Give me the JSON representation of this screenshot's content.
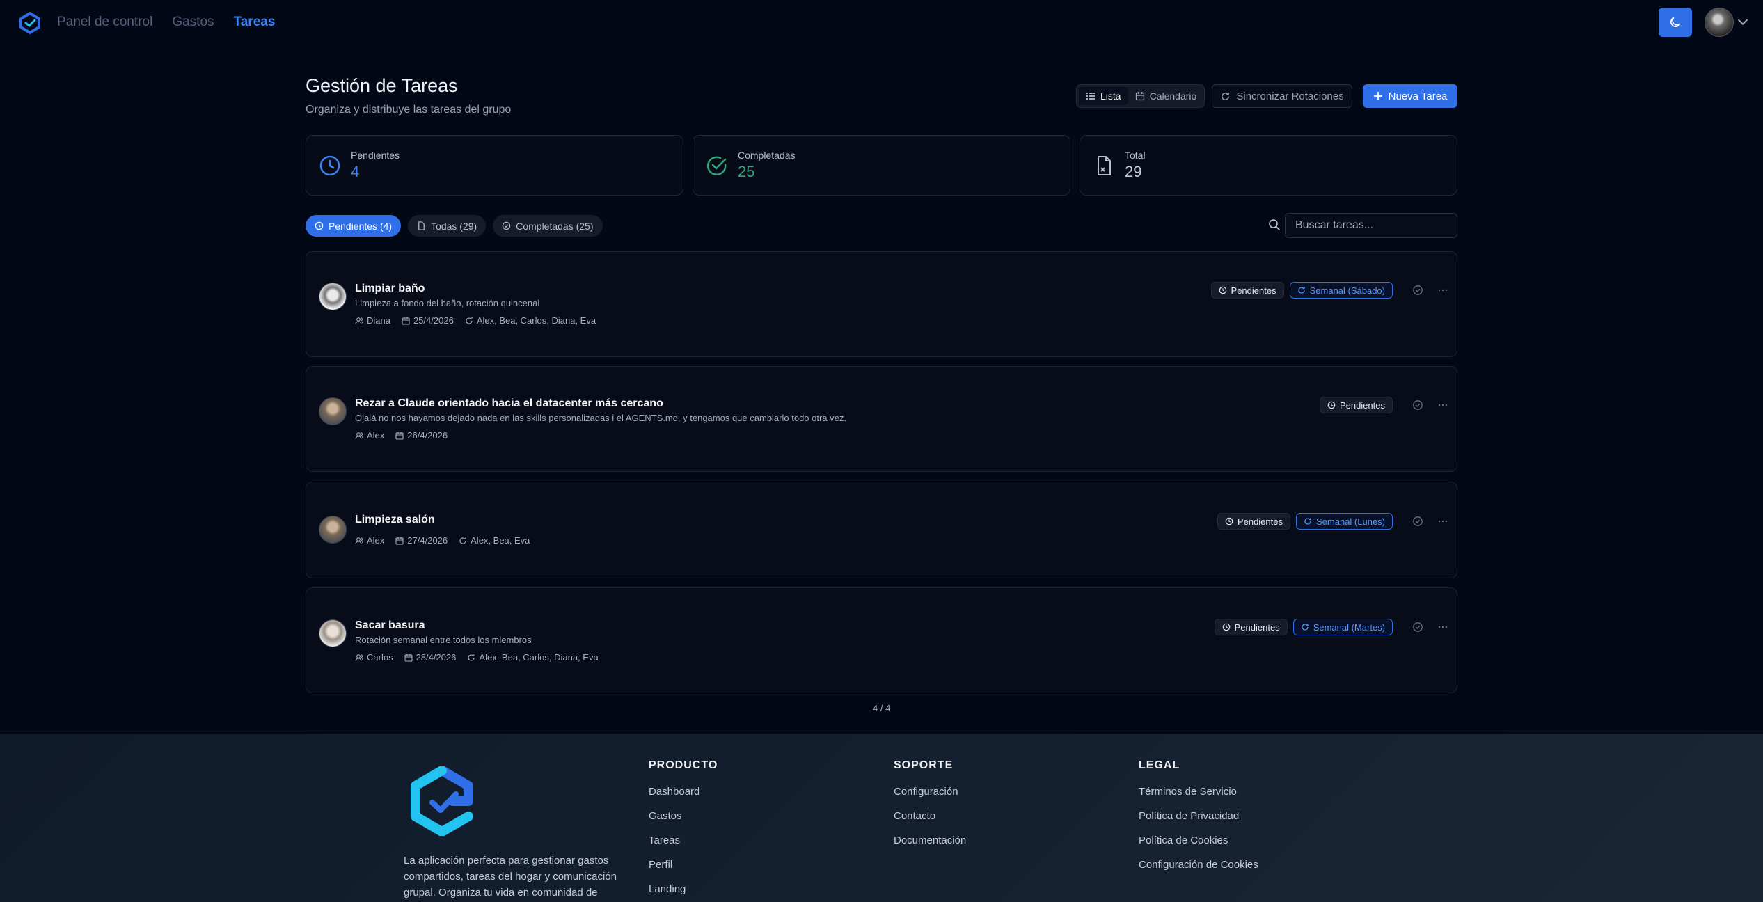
{
  "nav": {
    "items": [
      "Panel de control",
      "Gastos",
      "Tareas"
    ],
    "active": "Tareas"
  },
  "header": {
    "title": "Gestión de Tareas",
    "subtitle": "Organiza y distribuye las tareas del grupo"
  },
  "toolbar": {
    "view_list": "Lista",
    "view_calendar": "Calendario",
    "sync_label": "Sincronizar Rotaciones",
    "new_task_label": "Nueva Tarea"
  },
  "stats": {
    "pending": {
      "label": "Pendientes",
      "value": "4"
    },
    "completed": {
      "label": "Completadas",
      "value": "25"
    },
    "total": {
      "label": "Total",
      "value": "29"
    }
  },
  "filters": {
    "pending": "Pendientes (4)",
    "all": "Todas (29)",
    "completed": "Completadas (25)"
  },
  "search": {
    "placeholder": "Buscar tareas..."
  },
  "tasks": [
    {
      "name": "Limpiar baño",
      "description": "Limpieza a fondo del baño, rotación quincenal",
      "assignee": "Diana",
      "date": "25/4/2026",
      "rotation": "Alex, Bea, Carlos, Diana, Eva",
      "status": "Pendientes",
      "recurrence": "Semanal (Sábado)"
    },
    {
      "name": "Rezar a Claude orientado hacia el datacenter más cercano",
      "description": "Ojalá no nos hayamos dejado nada en las skills personalizadas i el AGENTS.md, y tengamos que cambiarlo todo otra vez.",
      "assignee": "Alex",
      "date": "26/4/2026",
      "rotation": "",
      "status": "Pendientes",
      "recurrence": ""
    },
    {
      "name": "Limpieza salón",
      "description": "",
      "assignee": "Alex",
      "date": "27/4/2026",
      "rotation": "Alex, Bea, Eva",
      "status": "Pendientes",
      "recurrence": "Semanal (Lunes)"
    },
    {
      "name": "Sacar basura",
      "description": "Rotación semanal entre todos los miembros",
      "assignee": "Carlos",
      "date": "28/4/2026",
      "rotation": "Alex, Bea, Carlos, Diana, Eva",
      "status": "Pendientes",
      "recurrence": "Semanal (Martes)"
    }
  ],
  "pagination": "4 / 4",
  "footer": {
    "description": "La aplicación perfecta para gestionar gastos compartidos, tareas del hogar y comunicación grupal. Organiza tu vida en comunidad de",
    "product": {
      "title": "PRODUCTO",
      "links": [
        "Dashboard",
        "Gastos",
        "Tareas",
        "Perfil",
        "Landing"
      ]
    },
    "support": {
      "title": "SOPORTE",
      "links": [
        "Configuración",
        "Contacto",
        "Documentación"
      ]
    },
    "legal": {
      "title": "LEGAL",
      "links": [
        "Términos de Servicio",
        "Política de Privacidad",
        "Política de Cookies",
        "Configuración de Cookies"
      ]
    }
  },
  "colors": {
    "accent": "#2f6fe8",
    "background": "#020816",
    "completed": "#2ea97a"
  }
}
